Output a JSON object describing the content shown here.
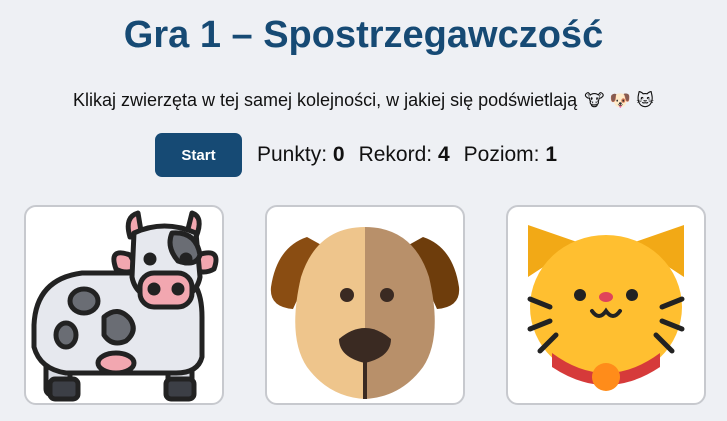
{
  "title": "Gra 1 – Spostrzegawczość",
  "instruction": "Klikaj zwierzęta w tej samej kolejności, w jakiej się podświetlają",
  "instruction_emojis": "🐮 🐶 🐱",
  "start_label": "Start",
  "stats": {
    "points_label": "Punkty:",
    "points_value": "0",
    "record_label": "Rekord:",
    "record_value": "4",
    "level_label": "Poziom:",
    "level_value": "1"
  },
  "animals": [
    {
      "name": "cow-icon"
    },
    {
      "name": "dog-icon"
    },
    {
      "name": "cat-icon"
    }
  ],
  "colors": {
    "accent": "#164a74",
    "background": "#eef0f4",
    "card_border": "#c7c9ce"
  }
}
